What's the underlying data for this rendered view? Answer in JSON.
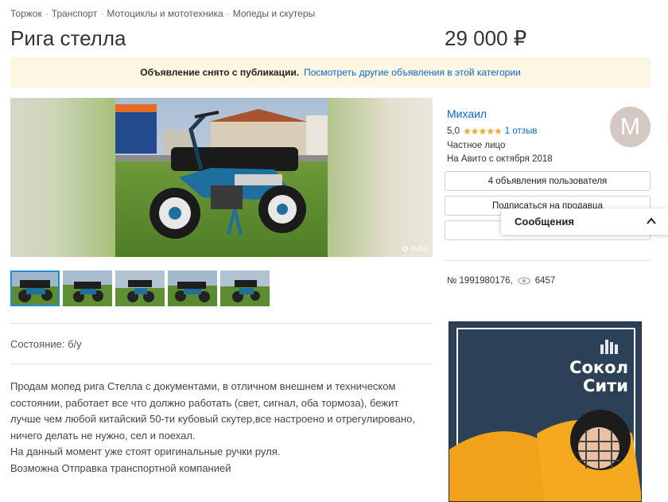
{
  "breadcrumbs": [
    "Торжок",
    "Транспорт",
    "Мотоциклы и мототехника",
    "Мопеды и скутеры"
  ],
  "listing": {
    "title": "Рига стелла",
    "price": "29 000 ₽",
    "condition": "Состояние: б/у",
    "description": [
      "Продам мопед рига Стелла с документами, в отличном внешнем и техническом",
      "состоянии, работает все что должно работать (свет, сигнал, оба тормоза), бежит",
      "лучше чем любой китайский 50-ти кубовый скутер,все настроено и отрегулировано,",
      "ничего делать не нужно, сел и поехал.",
      "На данный момент уже стоят оригинальные ручки руля.",
      "Возможна Отправка транспортной компанией"
    ],
    "id_text": "№ 1991980176,",
    "views": "6457",
    "watermark": "Avito"
  },
  "notice": {
    "text": "Объявление снято с публикации.",
    "link": "Посмотреть другие объявления в этой категории"
  },
  "seller": {
    "name": "Михаил",
    "rating": "5,0",
    "reviews": "1 отзыв",
    "type": "Частное лицо",
    "since": "На Авито с октября 2018",
    "avatar_letter": "M",
    "buttons": {
      "listings": "4 объявления пользователя",
      "subscribe": "Подписаться на продавца"
    }
  },
  "messages": {
    "label": "Сообщения"
  },
  "ad": {
    "line1": "Сокол",
    "line2": "Сити"
  },
  "colors": {
    "link": "#0a69c7",
    "notice_bg": "#fdf6e3",
    "star": "#f5a623",
    "thumb_active": "#1e8ed8"
  },
  "icons": [
    "eye-icon",
    "chevron-up-icon",
    "star-icon",
    "avito-logo-icon"
  ]
}
